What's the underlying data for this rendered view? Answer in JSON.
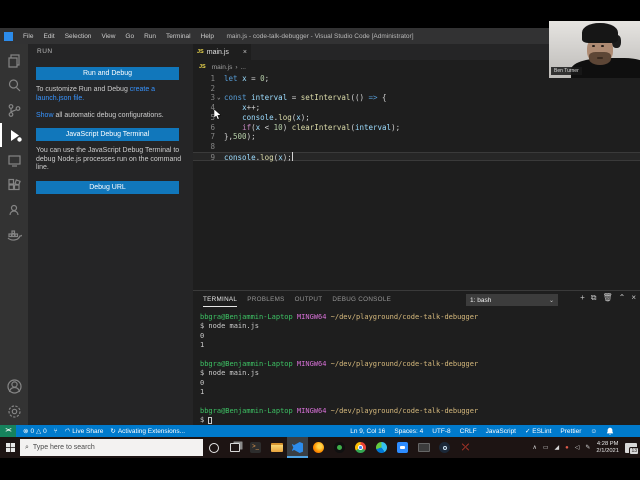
{
  "window": {
    "title": "main.js - code-talk-debugger - Visual Studio Code [Administrator]"
  },
  "menu_bar": {
    "items": [
      "File",
      "Edit",
      "Selection",
      "View",
      "Go",
      "Run",
      "Terminal",
      "Help"
    ]
  },
  "activity_bar": {
    "items": [
      {
        "name": "explorer",
        "active": false
      },
      {
        "name": "search",
        "active": false
      },
      {
        "name": "source-control",
        "active": false
      },
      {
        "name": "run-debug",
        "active": true
      },
      {
        "name": "remote-explorer",
        "active": false
      },
      {
        "name": "extensions",
        "active": false
      },
      {
        "name": "live-share",
        "active": false
      },
      {
        "name": "docker",
        "active": false
      }
    ],
    "bottom_items": [
      {
        "name": "account",
        "active": false
      },
      {
        "name": "settings",
        "active": false
      }
    ]
  },
  "sidebar": {
    "header": "RUN",
    "run_debug_button": "Run and Debug",
    "customize_text": "To customize Run and Debug ",
    "customize_link": "create a launch.json file.",
    "show_link": "Show",
    "show_text": " all automatic debug configurations.",
    "js_terminal_button": "JavaScript Debug Terminal",
    "js_terminal_text": "You can use the JavaScript Debug Terminal to debug Node.js processes run on the command line.",
    "debug_url_button": "Debug URL"
  },
  "editor": {
    "tab": {
      "label": "main.js",
      "icon": "JS",
      "close": "×"
    },
    "breadcrumb": {
      "icon": "JS",
      "file": "main.js",
      "chevron": "›",
      "more": "..."
    },
    "current_line": 9,
    "cursor": {
      "line": 9,
      "col": 16
    },
    "code_lines": [
      {
        "n": 1,
        "fold": "",
        "tokens": [
          [
            "kw",
            "let "
          ],
          [
            "v",
            "x "
          ],
          [
            "p",
            "= "
          ],
          [
            "num",
            "0"
          ],
          [
            "p",
            ";"
          ]
        ]
      },
      {
        "n": 2,
        "fold": "",
        "tokens": []
      },
      {
        "n": 3,
        "fold": "⌄",
        "tokens": [
          [
            "kw",
            "const "
          ],
          [
            "v",
            "interval "
          ],
          [
            "p",
            "= "
          ],
          [
            "fn",
            "setInterval"
          ],
          [
            "p",
            "(() "
          ],
          [
            "kw",
            "=> "
          ],
          [
            "p",
            "{"
          ]
        ]
      },
      {
        "n": 4,
        "fold": "",
        "tokens": [
          [
            "p",
            "    "
          ],
          [
            "v",
            "x"
          ],
          [
            "p",
            "++;"
          ]
        ]
      },
      {
        "n": 5,
        "fold": "",
        "tokens": [
          [
            "p",
            "    "
          ],
          [
            "v",
            "console"
          ],
          [
            "p",
            "."
          ],
          [
            "fn",
            "log"
          ],
          [
            "p",
            "("
          ],
          [
            "v",
            "x"
          ],
          [
            "p",
            ");"
          ]
        ]
      },
      {
        "n": 6,
        "fold": "",
        "tokens": [
          [
            "p",
            "    "
          ],
          [
            "ctl",
            "if"
          ],
          [
            "p",
            "("
          ],
          [
            "v",
            "x"
          ],
          [
            "p",
            " < "
          ],
          [
            "num",
            "10"
          ],
          [
            "p",
            ") "
          ],
          [
            "fn",
            "clearInterval"
          ],
          [
            "p",
            "("
          ],
          [
            "v",
            "interval"
          ],
          [
            "p",
            ");"
          ]
        ]
      },
      {
        "n": 7,
        "fold": "",
        "tokens": [
          [
            "p",
            "},"
          ],
          [
            "num",
            "500"
          ],
          [
            "p",
            ");"
          ]
        ]
      },
      {
        "n": 8,
        "fold": "",
        "tokens": []
      },
      {
        "n": 9,
        "fold": "",
        "tokens": [
          [
            "v",
            "console"
          ],
          [
            "p",
            "."
          ],
          [
            "fn",
            "log"
          ],
          [
            "p",
            "("
          ],
          [
            "v",
            "x"
          ],
          [
            "p",
            ");"
          ]
        ]
      }
    ]
  },
  "terminal": {
    "tabs": [
      {
        "label": "TERMINAL",
        "active": true
      },
      {
        "label": "PROBLEMS",
        "active": false
      },
      {
        "label": "OUTPUT",
        "active": false
      },
      {
        "label": "DEBUG CONSOLE",
        "active": false
      }
    ],
    "shell_select": "1: bash",
    "action_icons": [
      "plus",
      "split",
      "trash",
      "chevron-up",
      "close"
    ],
    "lines": [
      {
        "tokens": [
          [
            "tg",
            "bbgra@Benjammin-Laptop"
          ],
          [
            "tm",
            " MINGW64"
          ],
          [
            "ty",
            " ~/dev/playground/code-talk-debugger"
          ]
        ]
      },
      {
        "tokens": [
          [
            "tw",
            "$ node main.js"
          ]
        ]
      },
      {
        "tokens": [
          [
            "tw",
            "0"
          ]
        ]
      },
      {
        "tokens": [
          [
            "tw",
            "1"
          ]
        ]
      },
      {
        "tokens": []
      },
      {
        "tokens": [
          [
            "tg",
            "bbgra@Benjammin-Laptop"
          ],
          [
            "tm",
            " MINGW64"
          ],
          [
            "ty",
            " ~/dev/playground/code-talk-debugger"
          ]
        ]
      },
      {
        "tokens": [
          [
            "tw",
            "$ node main.js"
          ]
        ]
      },
      {
        "tokens": [
          [
            "tw",
            "0"
          ]
        ]
      },
      {
        "tokens": [
          [
            "tw",
            "1"
          ]
        ]
      },
      {
        "tokens": []
      },
      {
        "tokens": [
          [
            "tg",
            "bbgra@Benjammin-Laptop"
          ],
          [
            "tm",
            " MINGW64"
          ],
          [
            "ty",
            " ~/dev/playground/code-talk-debugger"
          ]
        ]
      },
      {
        "tokens": [
          [
            "tw",
            "$ "
          ]
        ],
        "cursor": true
      }
    ]
  },
  "status_bar": {
    "remote_indicator": "><",
    "errors": "0",
    "warnings": "0",
    "live_share": "Live Share",
    "activating": "Activating Extensions...",
    "right_items": [
      "Ln 9, Col 16",
      "Spaces: 4",
      "UTF-8",
      "CRLF",
      "JavaScript",
      "✓ ESLint",
      "Prettier"
    ]
  },
  "taskbar": {
    "search_placeholder": "Type here to search",
    "app_icons": [
      "cortana",
      "task-view",
      "terminal-app",
      "file-explorer",
      "vscode",
      "firefox",
      "obs",
      "chrome",
      "edge",
      "zoom-camera",
      "screen-app",
      "steam",
      "red-tool"
    ],
    "tray": {
      "time": "4:28 PM",
      "date": "2/1/2021",
      "notification_count": "13"
    }
  },
  "webcam": {
    "name_label": "Ben Turner"
  },
  "colors": {
    "accent": "#007acc",
    "button_blue": "#1177bb",
    "remote_green": "#16825d",
    "link_blue": "#3794ff"
  }
}
